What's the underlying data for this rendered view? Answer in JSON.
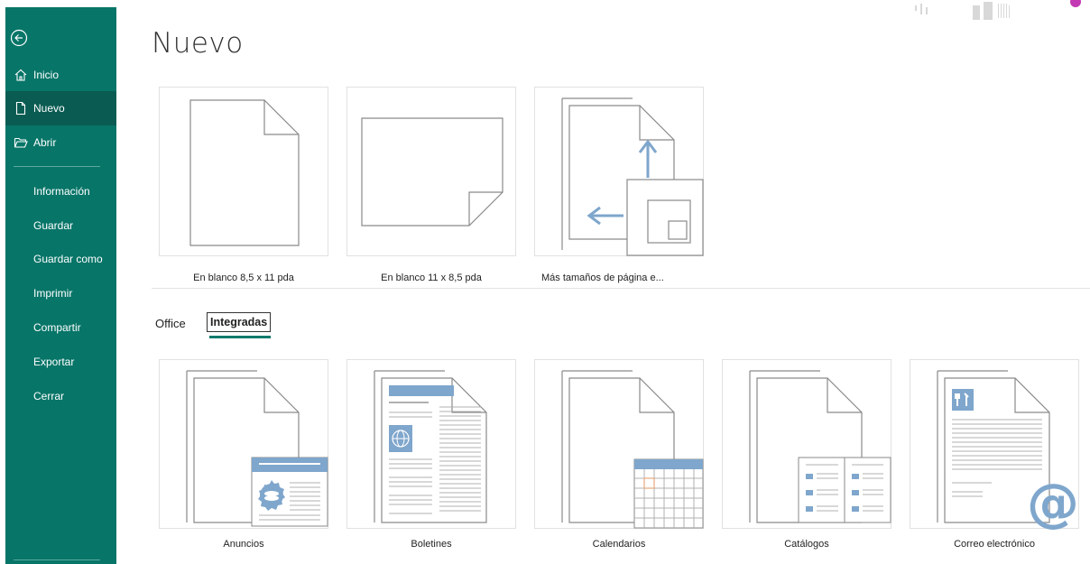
{
  "sidebar": {
    "back_icon": "back-arrow-circle-icon",
    "items": [
      {
        "label": "Inicio",
        "icon": "home-icon"
      },
      {
        "label": "Nuevo",
        "icon": "new-document-icon",
        "active": true
      },
      {
        "label": "Abrir",
        "icon": "open-folder-icon"
      }
    ],
    "links": [
      "Información",
      "Guardar",
      "Guardar como",
      "Imprimir",
      "Compartir",
      "Exportar",
      "Cerrar"
    ],
    "bg_color": "#077568",
    "active_color": "#0a5c52"
  },
  "main": {
    "title": "Nuevo",
    "blank_templates": [
      {
        "label": "En blanco 8,5 x 11 pda"
      },
      {
        "label": "En blanco 11 x 8,5 pda"
      },
      {
        "label": "Más tamaños de página e..."
      }
    ],
    "tabs": [
      {
        "label": "Office"
      },
      {
        "label": "Integradas",
        "selected": true
      }
    ],
    "categories": [
      {
        "label": "Anuncios"
      },
      {
        "label": "Boletines"
      },
      {
        "label": "Calendarios"
      },
      {
        "label": "Catálogos"
      },
      {
        "label": "Correo electrónico"
      }
    ],
    "accent_color": "#7fa6cc"
  }
}
